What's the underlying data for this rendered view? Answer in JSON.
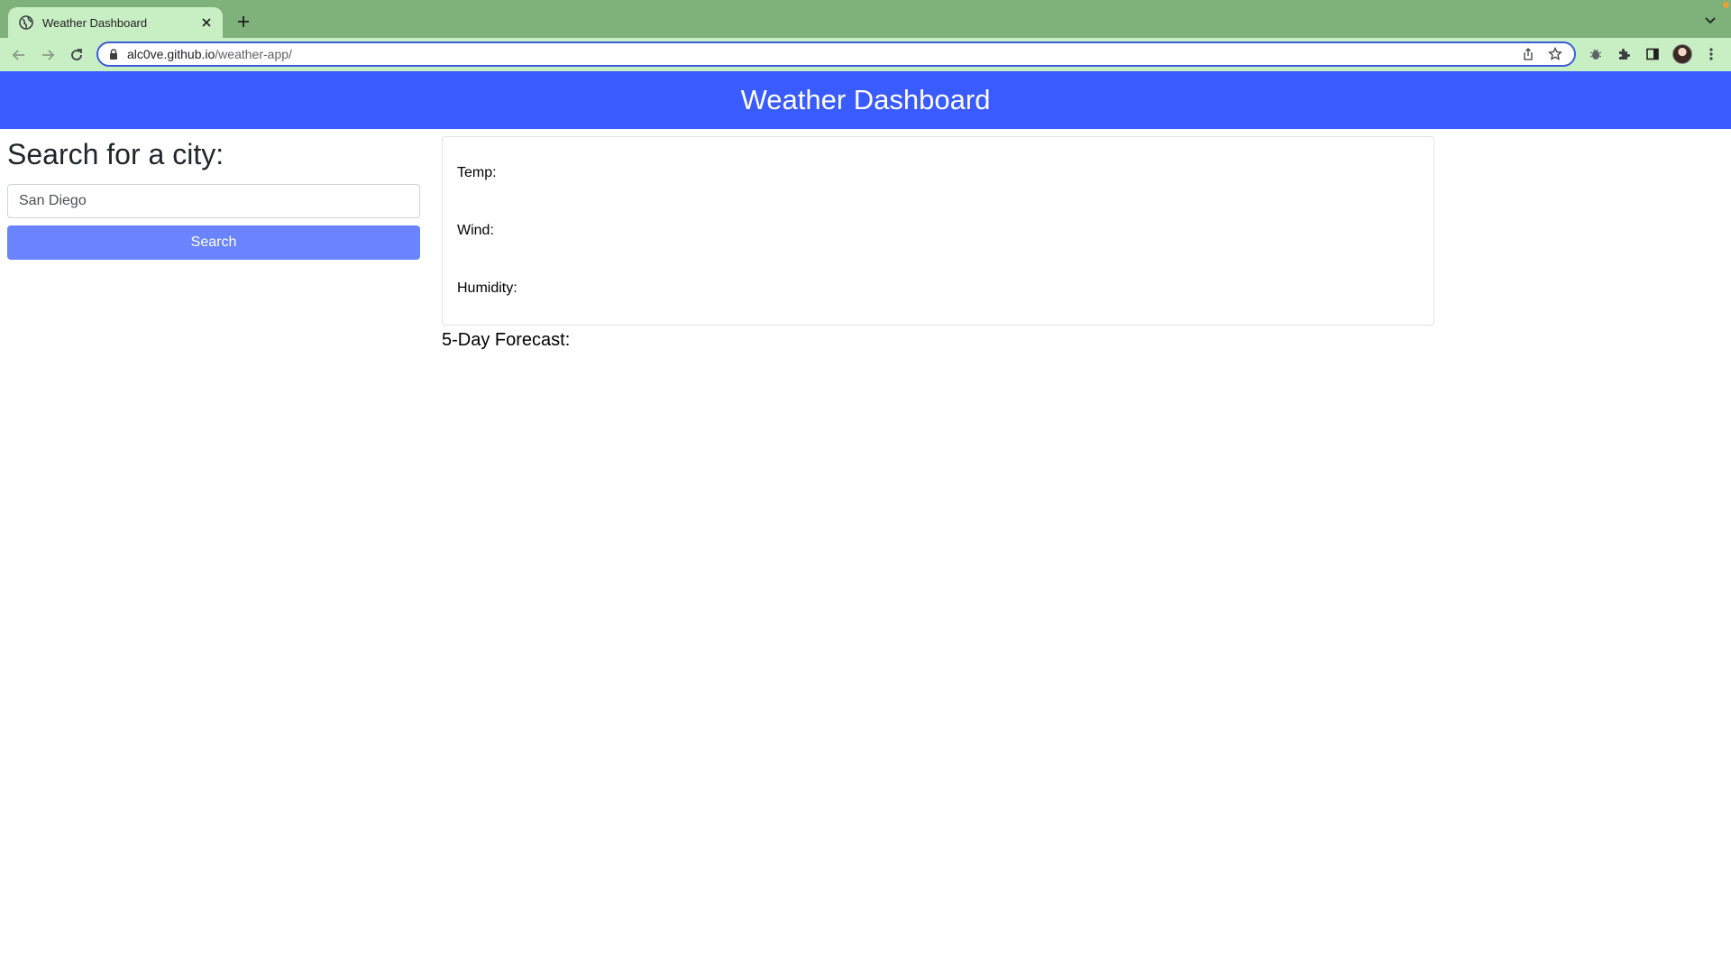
{
  "browser": {
    "tab": {
      "title": "Weather Dashboard",
      "favicon": "globe-icon"
    },
    "url": {
      "host": "alc0ve.github.io",
      "path": "/weather-app/"
    },
    "icons": [
      "back-arrow-icon",
      "forward-arrow-icon",
      "reload-icon",
      "lock-icon",
      "share-icon",
      "star-icon",
      "bug-extension-icon",
      "puzzle-extensions-icon",
      "side-panel-icon",
      "kebab-menu-icon"
    ]
  },
  "header": {
    "title": "Weather Dashboard"
  },
  "sidebar": {
    "heading": "Search for a city:",
    "search_value": "San Diego",
    "search_button": "Search"
  },
  "current": {
    "temp_label": "Temp:",
    "wind_label": "Wind:",
    "humidity_label": "Humidity:"
  },
  "forecast": {
    "title": "5-Day Forecast:"
  },
  "colors": {
    "header_bg": "#3a5bff",
    "button_bg": "#6a84ff",
    "tabstrip_bg": "#7fb17a",
    "toolbar_bg": "#c8eec4"
  }
}
